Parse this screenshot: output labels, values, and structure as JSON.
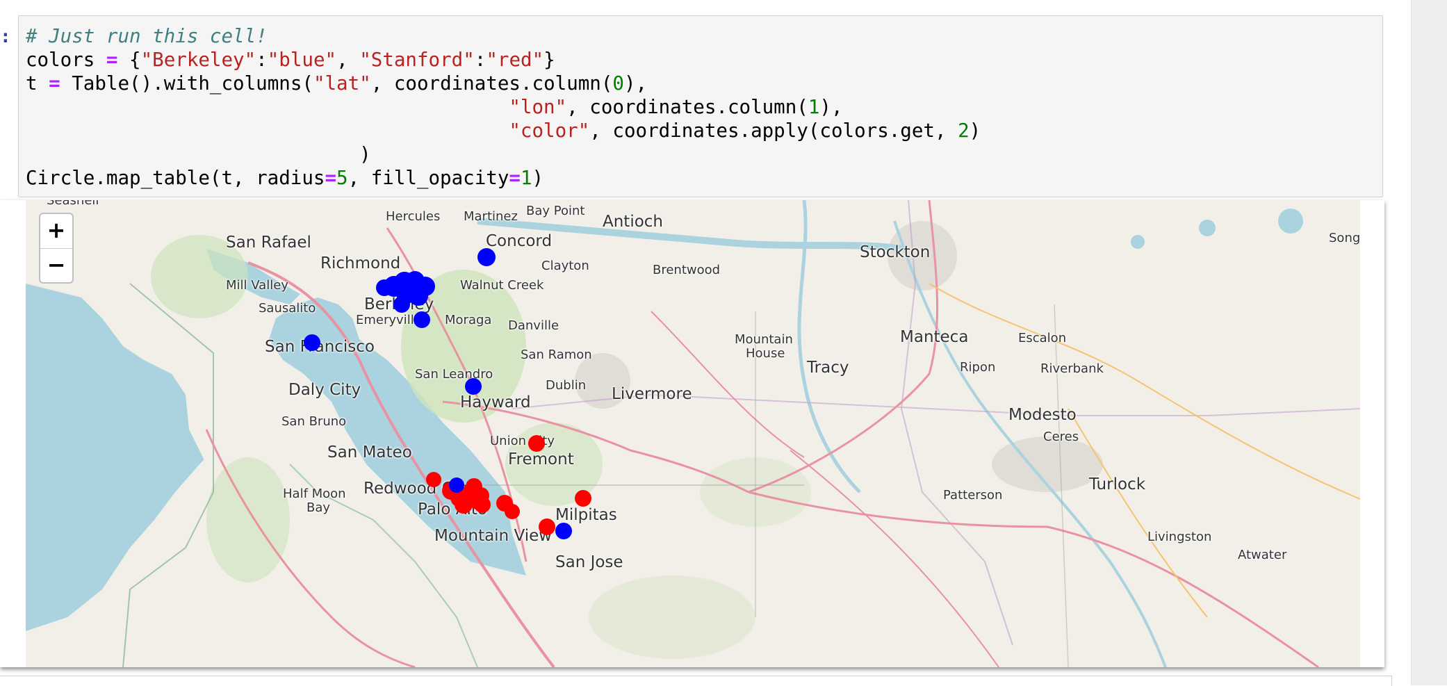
{
  "notebook": {
    "in_prompt": ":",
    "out_prompt": ":",
    "code": {
      "comment": "# Just run this cell!",
      "l2_a": "colors ",
      "l2_eq": "=",
      "l2_b": " {",
      "l2_s1": "\"Berkeley\"",
      "l2_c1": ":",
      "l2_s2": "\"blue\"",
      "l2_c2": ", ",
      "l2_s3": "\"Stanford\"",
      "l2_c3": ":",
      "l2_s4": "\"red\"",
      "l2_end": "}",
      "l3_a": "t ",
      "l3_eq": "=",
      "l3_b": " Table().with_columns(",
      "l3_s1": "\"lat\"",
      "l3_c": ", coordinates.column(",
      "l3_n": "0",
      "l3_end": "),",
      "l4_pad": "                                          ",
      "l4_s": "\"lon\"",
      "l4_c": ", coordinates.column(",
      "l4_n": "1",
      "l4_end": "),",
      "l5_pad": "                                          ",
      "l5_s": "\"color\"",
      "l5_c": ", coordinates.apply(colors.get, ",
      "l5_n": "2",
      "l5_end": ")",
      "l6": "                             )",
      "l7_a": "Circle.map_table(t, radius",
      "l7_eq1": "=",
      "l7_n1": "5",
      "l7_b": ", fill_opacity",
      "l7_eq2": "=",
      "l7_n2": "1",
      "l7_end": ")"
    }
  },
  "map": {
    "zoom_in": "+",
    "zoom_out": "−",
    "labels": {
      "seashell": "Seashell",
      "hercules": "Hercules",
      "martinez": "Martinez",
      "bay_point": "Bay Point",
      "antioch": "Antioch",
      "san_rafael": "San Rafael",
      "concord": "Concord",
      "richmond": "Richmond",
      "clayton": "Clayton",
      "brentwood": "Brentwood",
      "stockton": "Stockton",
      "song": "Song",
      "mill_valley": "Mill Valley",
      "walnut_creek": "Walnut Creek",
      "sausalito": "Sausalito",
      "berkeley": "Berkeley",
      "emeryville": "Emeryville",
      "moraga": "Moraga",
      "danville": "Danville",
      "san_francisco": "San Francisco",
      "mountain_house_1": "Mountain",
      "mountain_house_2": "House",
      "manteca": "Manteca",
      "escalon": "Escalon",
      "san_ramon": "San Ramon",
      "tracy": "Tracy",
      "ripon": "Ripon",
      "riverbank": "Riverbank",
      "san_leandro": "San Leandro",
      "daly_city": "Daly City",
      "dublin": "Dublin",
      "livermore": "Livermore",
      "hayward": "Hayward",
      "modesto": "Modesto",
      "san_bruno": "San Bruno",
      "ceres": "Ceres",
      "union_city": "Union City",
      "san_mateo": "San Mateo",
      "fremont": "Fremont",
      "turlock": "Turlock",
      "half_moon_1": "Half Moon",
      "half_moon_2": "Bay",
      "redwood_city": "Redwood City",
      "patterson": "Patterson",
      "palo_alto": "Palo Alto",
      "milpitas": "Milpitas",
      "mountain_view": "Mountain View",
      "livingston": "Livingston",
      "atwater": "Atwater",
      "san_jose": "San Jose"
    },
    "marker_colors": {
      "Berkeley": "#0000ff",
      "Stanford": "#ff0000"
    }
  }
}
